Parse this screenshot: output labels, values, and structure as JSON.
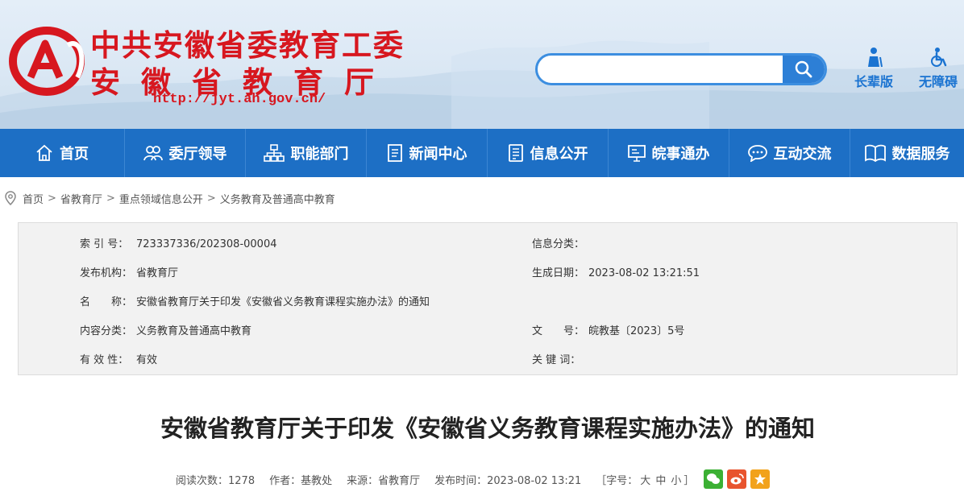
{
  "header": {
    "title_line1": "中共安徽省委教育工委",
    "title_line2": "安徽省教育厅",
    "url": "http://jyt.ah.gov.cn/",
    "search": {
      "placeholder": "",
      "value": ""
    },
    "utilities": [
      {
        "label": "长辈版",
        "icon": "elder-person-icon"
      },
      {
        "label": "无障碍",
        "icon": "wheelchair-icon"
      }
    ],
    "brand_color": "#d7171f",
    "accent_color": "#1d6fc5"
  },
  "nav": {
    "items": [
      {
        "label": "首页",
        "icon": "home-icon"
      },
      {
        "label": "委厅领导",
        "icon": "people-icon"
      },
      {
        "label": "职能部门",
        "icon": "org-chart-icon"
      },
      {
        "label": "新闻中心",
        "icon": "document-icon"
      },
      {
        "label": "信息公开",
        "icon": "info-list-icon"
      },
      {
        "label": "皖事通办",
        "icon": "monitor-icon"
      },
      {
        "label": "互动交流",
        "icon": "chat-icon"
      },
      {
        "label": "数据服务",
        "icon": "book-icon"
      }
    ]
  },
  "breadcrumb": [
    "首页",
    "省教育厅",
    "重点领域信息公开",
    "义务教育及普通高中教育"
  ],
  "info": {
    "index_no_label": "索 引 号：",
    "index_no": "723337336/202308-00004",
    "category_label": "信息分类：",
    "category": "",
    "publisher_label": "发布机构：",
    "publisher": "省教育厅",
    "created_label": "生成日期：",
    "created": "2023-08-02 13:21:51",
    "name_label": "名　　称：",
    "name": "安徽省教育厅关于印发《安徽省义务教育课程实施办法》的通知",
    "content_cat_label": "内容分类：",
    "content_cat": "义务教育及普通高中教育",
    "doc_no_label": "文　　号：",
    "doc_no": "皖教基〔2023〕5号",
    "validity_label": "有 效 性：",
    "validity": "有效",
    "keywords_label": "关 键 词：",
    "keywords": ""
  },
  "article": {
    "title": "安徽省教育厅关于印发《安徽省义务教育课程实施办法》的通知",
    "reads": "阅读次数：1278",
    "author": "作者：基教处",
    "source": "来源：省教育厅",
    "published": "发布时间：2023-08-02 13:21",
    "font_size_prefix": "［字号：",
    "font_large": "大",
    "font_medium": "中",
    "font_small": "小",
    "font_size_suffix": "］",
    "share": [
      "wechat-icon",
      "weibo-icon",
      "favorite-icon"
    ]
  }
}
